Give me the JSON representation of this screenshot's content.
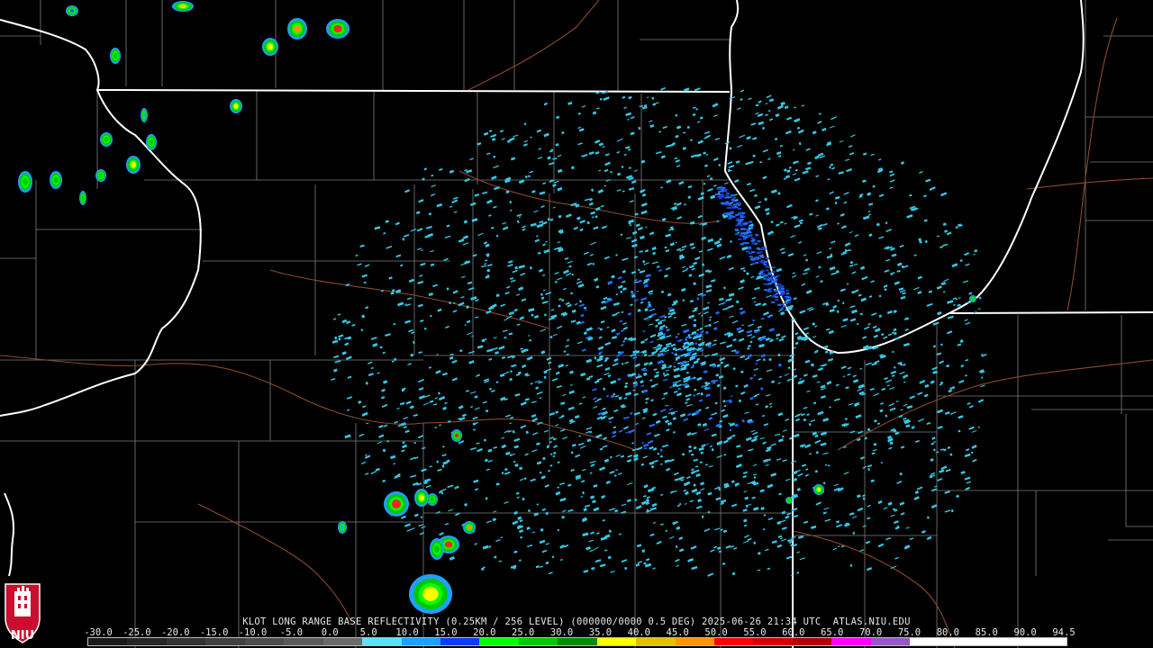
{
  "caption": "KLOT LONG RANGE BASE REFLECTIVITY (0.25KM / 256 LEVEL) (000000/0000 0.5 DEG) 2025-06-26 21:34 UTC  ATLAS.NIU.EDU",
  "scale": {
    "labels": [
      "-30.0",
      "-25.0",
      "-20.0",
      "-15.0",
      "-10.0",
      "-5.0",
      "0.0",
      "5.0",
      "10.0",
      "15.0",
      "20.0",
      "25.0",
      "30.0",
      "35.0",
      "40.0",
      "45.0",
      "50.0",
      "55.0",
      "60.0",
      "65.0",
      "70.0",
      "75.0",
      "80.0",
      "85.0",
      "90.0",
      "94.5"
    ],
    "colors": [
      "#1a1a1a",
      "#262626",
      "#333333",
      "#404040",
      "#4d4d4d",
      "#5a5a5a",
      "#6a6a6a",
      "#5fe0ff",
      "#1ea0ff",
      "#0a3cff",
      "#00ff00",
      "#00c800",
      "#008c00",
      "#ffff00",
      "#e6c000",
      "#ff9600",
      "#ff0000",
      "#d40000",
      "#b00000",
      "#ff00ff",
      "#9955c9",
      "#ffffff",
      "#ffffff",
      "#ffffff",
      "#ffffff"
    ]
  },
  "logo": {
    "text": "NIU",
    "primary": "#c8102e"
  },
  "colors": {
    "state_border": "#ffffff",
    "county_line": "#8a8a8a",
    "river": "#8b4a2b",
    "light_echo": "#35c8e6",
    "mid_echo": "#1e6cff"
  }
}
